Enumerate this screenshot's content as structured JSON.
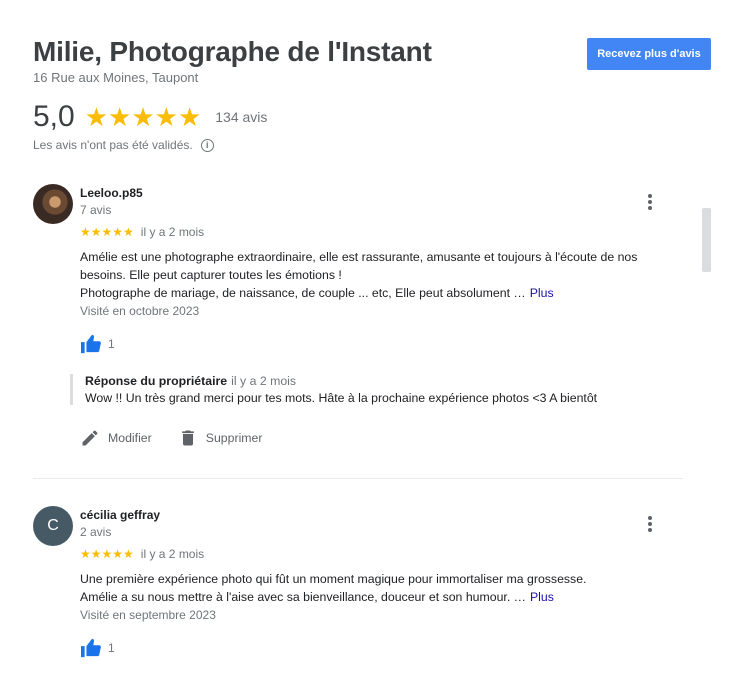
{
  "business": {
    "name": "Milie, Photographe de l'Instant",
    "address": "16 Rue aux Moines, Taupont",
    "cta_label": "Recevez plus d'avis"
  },
  "rating": {
    "score": "5,0",
    "stars": "★★★★★",
    "count_label": "134 avis",
    "disclaimer": "Les avis n'ont pas été validés.",
    "info_glyph": "i"
  },
  "reviews": [
    {
      "author": "Leeloo.p85",
      "avatar": "photo",
      "count": "7 avis",
      "stars": "★★★★★",
      "date": "il y a 2 mois",
      "text_lines": [
        "Amélie est une photographe extraordinaire, elle est rassurante, amusante et toujours à l'écoute de nos",
        "besoins. Elle peut capturer toutes les émotions !",
        "Photographe de mariage, de naissance, de couple ... etc, Elle peut absolument …"
      ],
      "more_label": "Plus",
      "visited": "Visité en octobre 2023",
      "likes": "1",
      "owner_reply": {
        "title": "Réponse du propriétaire",
        "date": "il y a 2 mois",
        "text": "Wow !! Un très grand merci pour tes mots. Hâte à la prochaine expérience photos <3 A bientôt"
      },
      "actions": {
        "edit_label": "Modifier",
        "delete_label": "Supprimer"
      }
    },
    {
      "author": "cécilia geffray",
      "avatar_letter": "C",
      "count": "2 avis",
      "stars": "★★★★★",
      "date": "il y a 2 mois",
      "text_lines": [
        "Une première expérience photo qui fût un moment magique pour immortaliser ma grossesse.",
        "Amélie a su nous mettre à l'aise avec sa bienveillance, douceur et son humour. …"
      ],
      "more_label": "Plus",
      "visited": "Visité en septembre 2023",
      "likes": "1"
    }
  ],
  "colors": {
    "star": "#fbbc04",
    "accent": "#4285f4",
    "link": "#1a0dab",
    "thumb": "#1a73e8"
  },
  "icons": [
    "info-icon",
    "more-vert-icon",
    "thumb-up-icon",
    "edit-pencil-icon",
    "trash-icon"
  ]
}
